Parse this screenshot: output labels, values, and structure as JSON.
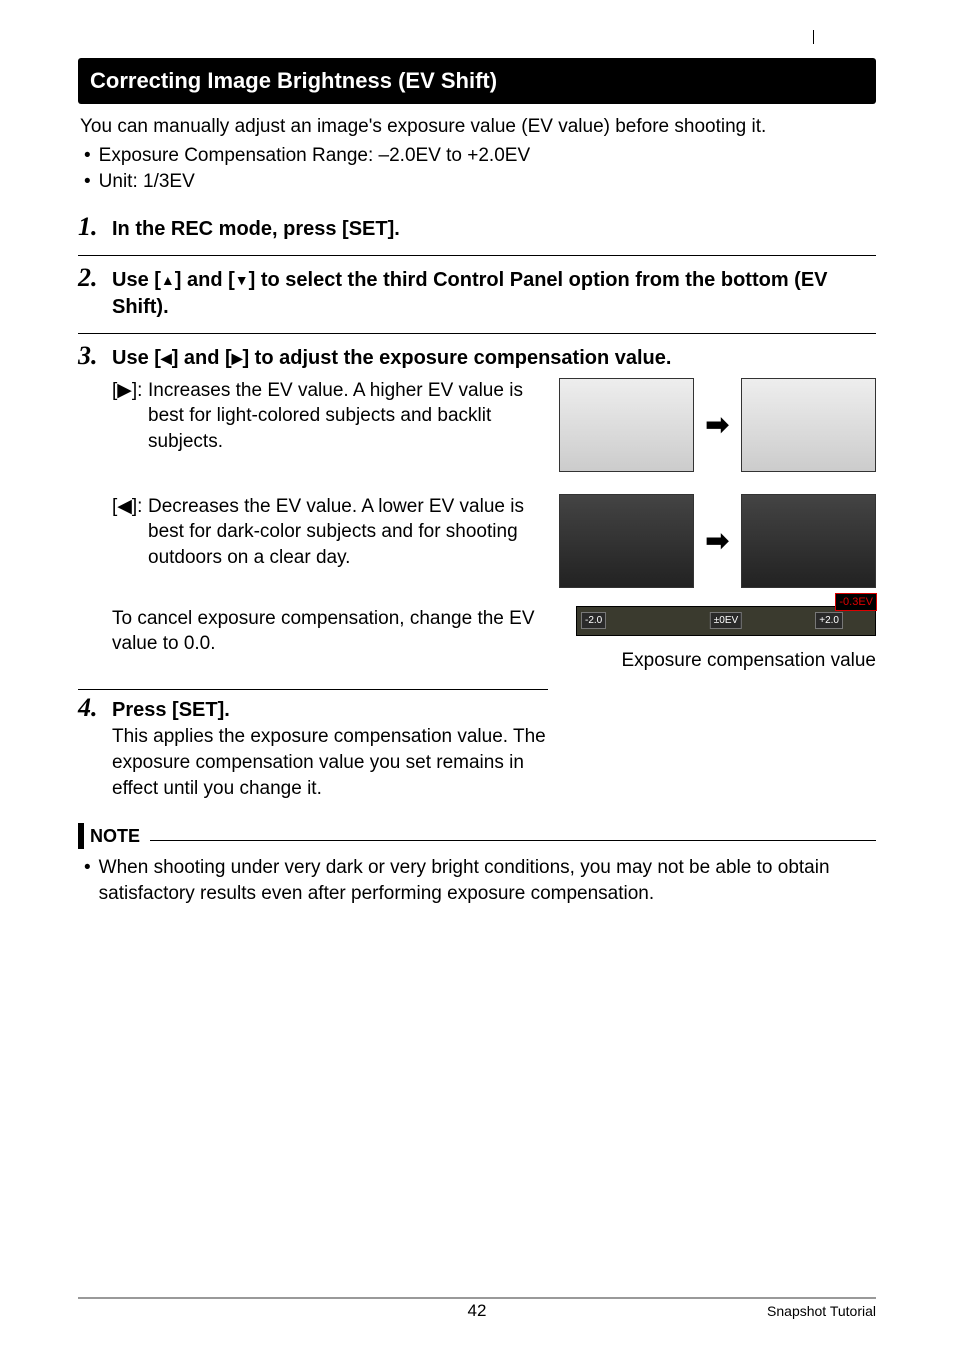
{
  "header": {
    "title": "Correcting Image Brightness (EV Shift)"
  },
  "intro": {
    "lead": "You can manually adjust an image's exposure value (EV value) before shooting it.",
    "bullets": [
      "Exposure Compensation Range: –2.0EV to +2.0EV",
      "Unit: 1/3EV"
    ]
  },
  "steps": {
    "s1": {
      "num": "1.",
      "title": "In the REC mode, press [SET]."
    },
    "s2": {
      "num": "2.",
      "title_pre": "Use [",
      "title_mid1": "] and [",
      "title_post": "] to select the third Control Panel option from the bottom (EV Shift)."
    },
    "s3": {
      "num": "3.",
      "title_pre": "Use [",
      "title_mid1": "] and [",
      "title_post": "] to adjust the exposure compensation value.",
      "right_key": "[▶]:",
      "right_key_text": "Increases the EV value. A higher EV value is best for light-colored subjects and backlit subjects.",
      "left_key": "[◀]:",
      "left_key_text": "Decreases the EV value. A lower EV value is best for dark-color subjects and for shooting outdoors on a clear day.",
      "cancel_text": "To cancel exposure compensation, change the EV value to 0.0.",
      "ev_bar": {
        "left": "-2.0",
        "mid": "±0EV",
        "right": "+2.0",
        "flag": "-0.3EV"
      },
      "ev_label": "Exposure compensation value"
    },
    "s4": {
      "num": "4.",
      "title": "Press [SET].",
      "body": "This applies the exposure compensation value. The exposure compensation value you set remains in effect until you change it."
    }
  },
  "note": {
    "title": "NOTE",
    "body": "When shooting under very dark or very bright conditions, you may not be able to obtain satisfactory results even after performing exposure compensation."
  },
  "footer": {
    "page": "42",
    "section": "Snapshot Tutorial"
  },
  "glyphs": {
    "up": "▲",
    "down": "▼",
    "left": "◀",
    "right": "▶",
    "arrow": "➡"
  }
}
